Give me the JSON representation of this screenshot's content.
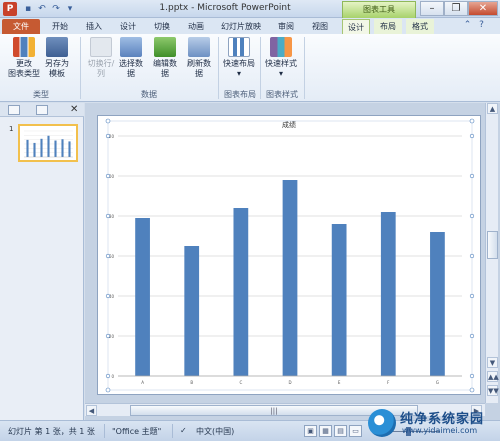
{
  "titlebar": {
    "logo": "P",
    "title": "1.pptx - Microsoft PowerPoint",
    "chart_tools": "图表工具",
    "icons": [
      "save-icon",
      "undo-icon",
      "redo-icon"
    ],
    "win_minimize": "–",
    "win_restore": "❐",
    "win_close": "✕"
  },
  "tabs": {
    "file": "文件",
    "home": "开始",
    "insert": "插入",
    "design": "设计",
    "transitions": "切换",
    "animations": "动画",
    "slideshow": "幻灯片放映",
    "review": "审阅",
    "view": "视图",
    "ctx_design": "设计",
    "ctx_layout": "布局",
    "ctx_format": "格式"
  },
  "ribbon": {
    "change_type": [
      "更改",
      "图表类型"
    ],
    "save_template": [
      "另存为",
      "模板"
    ],
    "group_type": "类型",
    "switch_row_col": "切换行/列",
    "select_data": "选择数据",
    "edit_data": "编辑数据",
    "refresh_data": "刷新数据",
    "group_data": "数据",
    "quick_layout": "快速布局",
    "group_layout": "图表布局",
    "quick_style": "快速样式",
    "group_style": "图表样式"
  },
  "leftpane": {
    "slide_number": "1",
    "close": "✕"
  },
  "chart_data": {
    "type": "bar",
    "title": "成绩",
    "categories": [
      "A",
      "B",
      "C",
      "D",
      "E",
      "F",
      "G"
    ],
    "values": [
      79,
      65,
      84,
      98,
      76,
      82,
      72
    ],
    "ylim": [
      0,
      120
    ],
    "yticks": [
      0,
      20,
      40,
      60,
      80,
      100,
      120
    ],
    "grid": true,
    "bar_color": "#4f81bd"
  },
  "scroll": {
    "up": "▲",
    "down": "▼",
    "page_up": "▲▲",
    "page_down": "▼▼",
    "hthumb_grip": "|||"
  },
  "status": {
    "slide_info": "幻灯片 第 1 张，共 1 张",
    "theme": "\"Office 主题\"",
    "language": "中文(中国)"
  },
  "watermark": {
    "text": "纯净系统家园",
    "url": "www.yidaimei.com"
  }
}
